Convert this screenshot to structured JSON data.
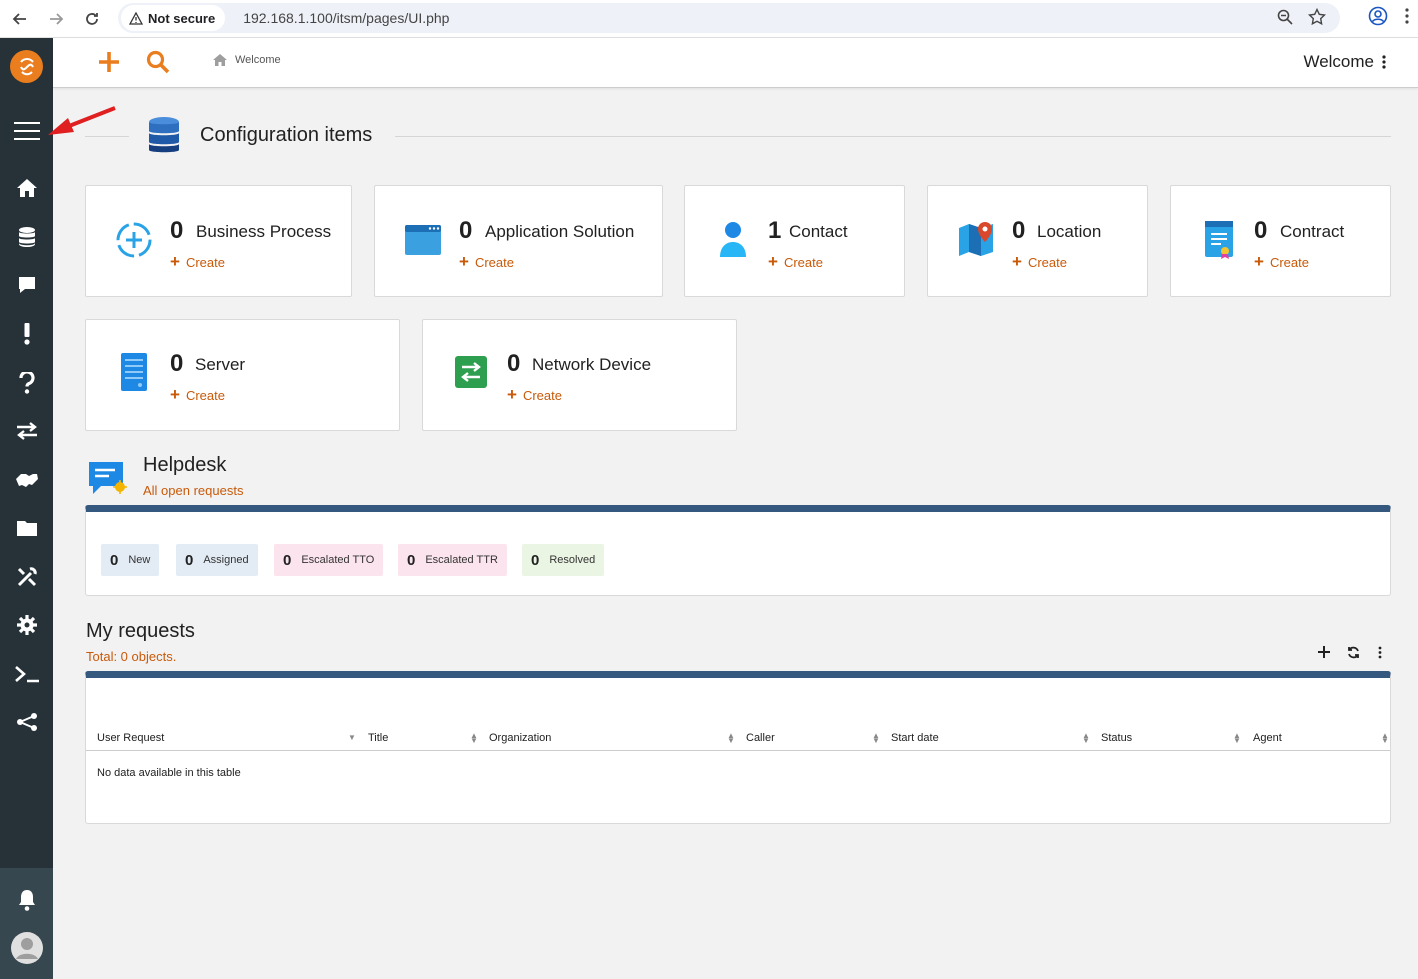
{
  "browser": {
    "security_label": "Not secure",
    "url": "192.168.1.100/itsm/pages/UI.php"
  },
  "topbar": {
    "breadcrumb": "Welcome",
    "welcome_menu": "Welcome"
  },
  "config_section": {
    "title": "Configuration items",
    "cards": [
      {
        "count": "0",
        "label": "Business Process",
        "create": "Create"
      },
      {
        "count": "0",
        "label": "Application Solution",
        "create": "Create"
      },
      {
        "count": "1",
        "label": "Contact",
        "create": "Create"
      },
      {
        "count": "0",
        "label": "Location",
        "create": "Create"
      },
      {
        "count": "0",
        "label": "Contract",
        "create": "Create"
      },
      {
        "count": "0",
        "label": "Server",
        "create": "Create"
      },
      {
        "count": "0",
        "label": "Network Device",
        "create": "Create"
      }
    ]
  },
  "helpdesk": {
    "title": "Helpdesk",
    "subtitle": "All open requests",
    "badges": [
      {
        "count": "0",
        "label": "New",
        "color": "#e3ecf5"
      },
      {
        "count": "0",
        "label": "Assigned",
        "color": "#e3ecf5"
      },
      {
        "count": "0",
        "label": "Escalated TTO",
        "color": "#fbe4ee"
      },
      {
        "count": "0",
        "label": "Escalated TTR",
        "color": "#fbe4ee"
      },
      {
        "count": "0",
        "label": "Resolved",
        "color": "#ebf5e4"
      }
    ]
  },
  "my_requests": {
    "title": "My requests",
    "subtitle": "Total: 0  objects.",
    "columns": [
      "User Request",
      "Title",
      "Organization",
      "Caller",
      "Start date",
      "Status",
      "Agent"
    ],
    "empty_text": "No data available in this table"
  },
  "colors": {
    "sidebar": "#263238",
    "accent": "#ea7d1e",
    "link": "#c85a0a",
    "table_header_bar": "#34587e"
  }
}
